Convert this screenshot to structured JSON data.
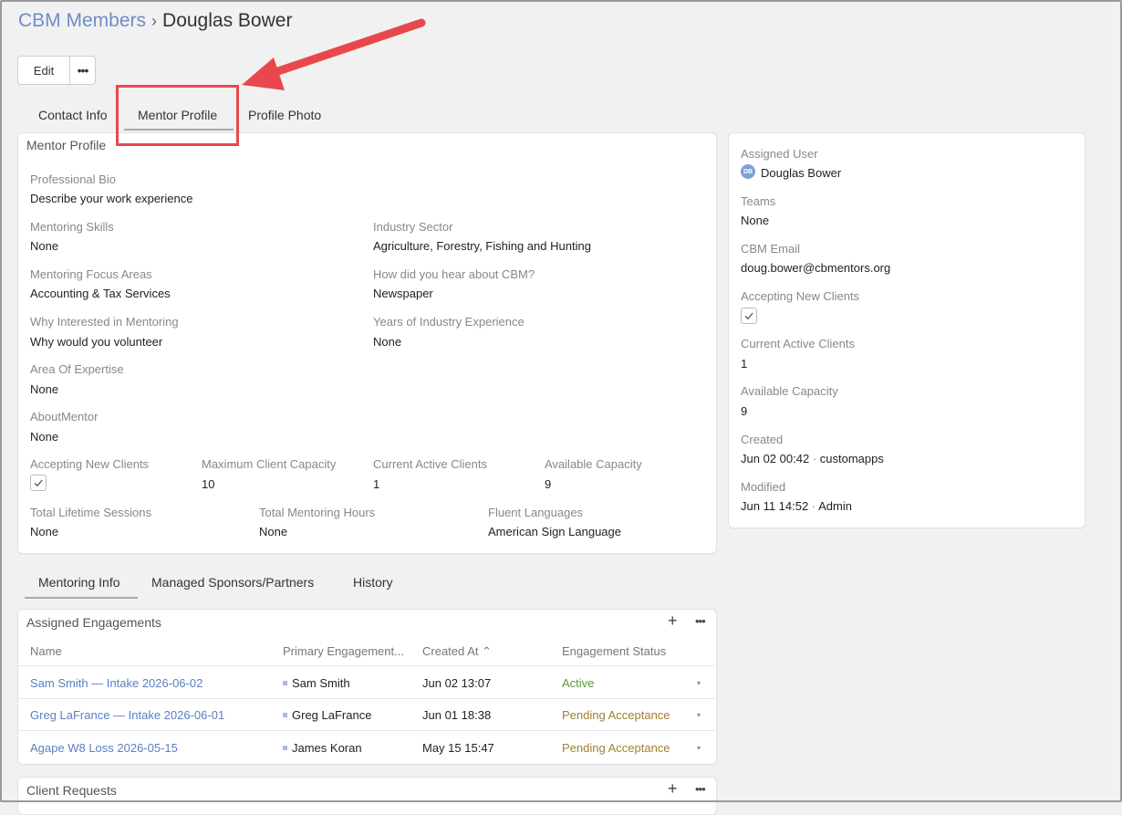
{
  "breadcrumb": {
    "root": "CBM Members",
    "separator": "›",
    "current": "Douglas Bower"
  },
  "actions": {
    "edit": "Edit",
    "more": "•••"
  },
  "top_tabs": [
    "Contact Info",
    "Mentor Profile",
    "Profile Photo"
  ],
  "mentor_profile": {
    "title": "Mentor Profile",
    "professional_bio": {
      "label": "Professional Bio",
      "value": "Describe your work experience"
    },
    "mentoring_skills": {
      "label": "Mentoring Skills",
      "value": "None"
    },
    "industry_sector": {
      "label": "Industry Sector",
      "value": "Agriculture, Forestry, Fishing and Hunting"
    },
    "focus_areas": {
      "label": "Mentoring Focus Areas",
      "value": "Accounting & Tax Services"
    },
    "hear_about": {
      "label": "How did you hear about CBM?",
      "value": "Newspaper"
    },
    "why_interested": {
      "label": "Why Interested in Mentoring",
      "value": "Why would you volunteer"
    },
    "years_experience": {
      "label": "Years of Industry Experience",
      "value": "None"
    },
    "area_expertise": {
      "label": "Area Of Expertise",
      "value": "None"
    },
    "about_mentor": {
      "label": "AboutMentor",
      "value": "None"
    },
    "accepting_clients": {
      "label": "Accepting New Clients",
      "checked": true
    },
    "max_capacity": {
      "label": "Maximum Client Capacity",
      "value": "10"
    },
    "current_active": {
      "label": "Current Active Clients",
      "value": "1"
    },
    "available_capacity": {
      "label": "Available Capacity",
      "value": "9"
    },
    "lifetime_sessions": {
      "label": "Total Lifetime Sessions",
      "value": "None"
    },
    "mentoring_hours": {
      "label": "Total Mentoring Hours",
      "value": "None"
    },
    "fluent_languages": {
      "label": "Fluent Languages",
      "value": "American Sign Language"
    }
  },
  "side_panel": {
    "assigned_user": {
      "label": "Assigned User",
      "initials": "DB",
      "value": "Douglas Bower"
    },
    "teams": {
      "label": "Teams",
      "value": "None"
    },
    "cbm_email": {
      "label": "CBM Email",
      "value": "doug.bower@cbmentors.org"
    },
    "accepting_clients": {
      "label": "Accepting New Clients",
      "checked": true
    },
    "current_active": {
      "label": "Current Active Clients",
      "value": "1"
    },
    "available_capacity": {
      "label": "Available Capacity",
      "value": "9"
    },
    "created": {
      "label": "Created",
      "date": "Jun 02 00:42",
      "dot": "·",
      "by": "customapps"
    },
    "modified": {
      "label": "Modified",
      "date": "Jun 11 14:52",
      "dot": "·",
      "by": "Admin"
    }
  },
  "bottom_tabs": [
    "Mentoring Info",
    "Managed Sponsors/Partners",
    "History"
  ],
  "engagements": {
    "title": "Assigned Engagements",
    "add": "+",
    "more": "•••",
    "columns": [
      "Name",
      "Primary Engagement...",
      "Created At",
      "Engagement Status"
    ],
    "sort_icon": "⌃",
    "rows": [
      {
        "name": "Sam Smith — Intake 2026-06-02",
        "contact": "Sam Smith",
        "created": "Jun 02 13:07",
        "status": "Active"
      },
      {
        "name": "Greg LaFrance — Intake 2026-06-01",
        "contact": "Greg LaFrance",
        "created": "Jun 01 18:38",
        "status": "Pending Acceptance"
      },
      {
        "name": "Agape W8 Loss 2026-05-15",
        "contact": "James Koran",
        "created": "May 15 15:47",
        "status": "Pending Acceptance"
      }
    ],
    "caret": "▾"
  },
  "client_requests": {
    "title": "Client Requests",
    "add": "+",
    "more": "•••"
  },
  "colors": {
    "accent": "#6d8ec7",
    "link": "#5b7fbf",
    "active": "#5a9a3c",
    "pending": "#a08134",
    "annotation": "#e8484d"
  }
}
